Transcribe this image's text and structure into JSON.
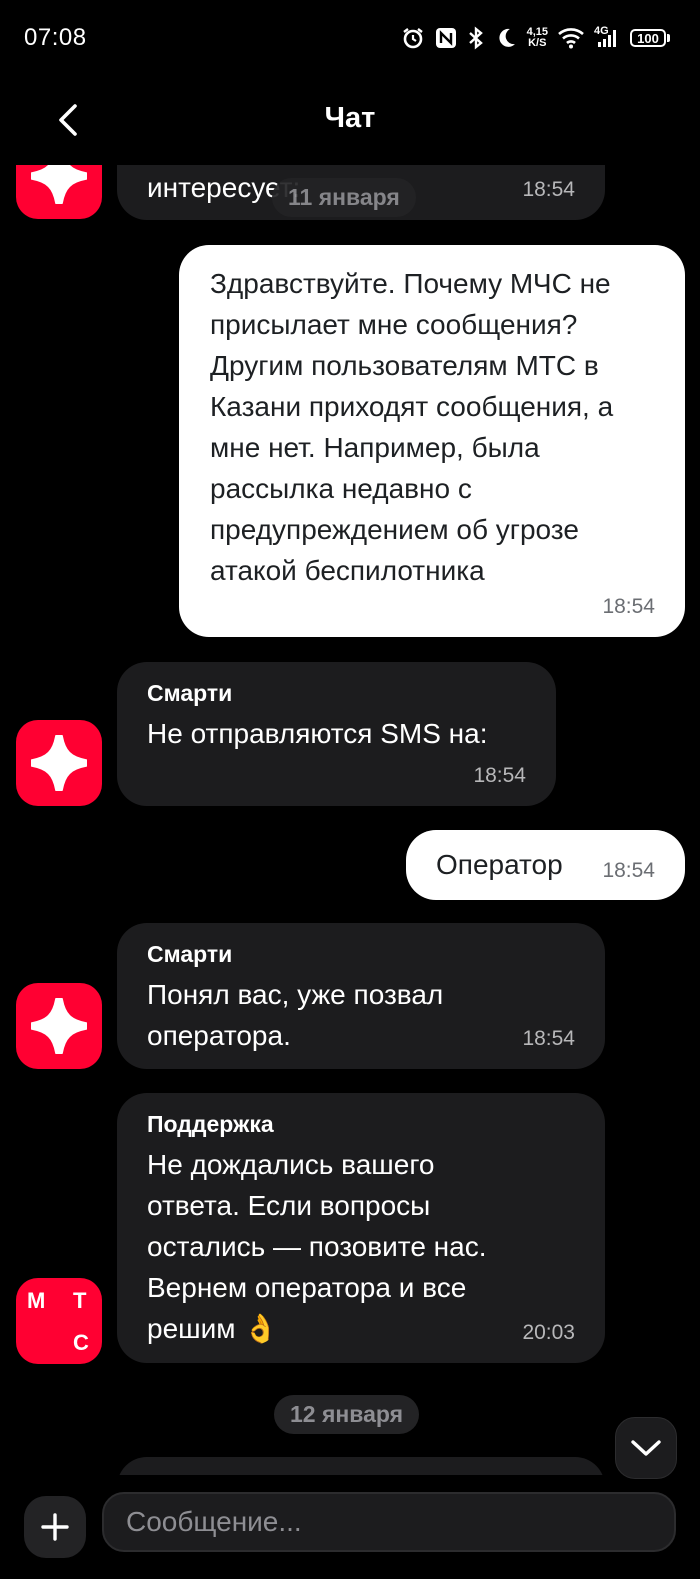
{
  "status_bar": {
    "time": "07:08",
    "net_speed_value": "4,15",
    "net_speed_unit": "K/S",
    "network_type": "4G",
    "battery": "100"
  },
  "header": {
    "title": "Чат"
  },
  "messages": [
    {
      "direction": "in",
      "text": "интересует:",
      "time": "18:54"
    },
    {
      "direction": "out",
      "text": "Здравствуйте. Почему МЧС не присылает мне сообщения? Другим пользователям МТС в Казани приходят сообщения, а мне нет. Например, была рассылка недавно с предупреждением об угрозе атакой беспилотника",
      "time": "18:54"
    },
    {
      "direction": "in",
      "sender": "Смарти",
      "text": "Не отправляются SMS на:",
      "time": "18:54"
    },
    {
      "direction": "out",
      "text": "Оператор",
      "time": "18:54"
    },
    {
      "direction": "in",
      "sender": "Смарти",
      "text": "Понял вас, уже позвал оператора.",
      "time": "18:54"
    },
    {
      "direction": "in",
      "sender": "Поддержка",
      "text": "Не дождались вашего ответа. Если вопросы остались — позовите нас. Вернем оператора и все решим 👌",
      "time": "20:03"
    }
  ],
  "date_chips": {
    "first": "11 января",
    "second": "12 января"
  },
  "mts_logo": {
    "letter_m": "М",
    "letter_t": "Т",
    "letter_s": "С"
  },
  "composer": {
    "placeholder": "Сообщение..."
  },
  "colors": {
    "background": "#000000",
    "incoming_bubble": "#1c1c1e",
    "outgoing_bubble": "#ffffff",
    "brand_red": "#ff0032"
  }
}
